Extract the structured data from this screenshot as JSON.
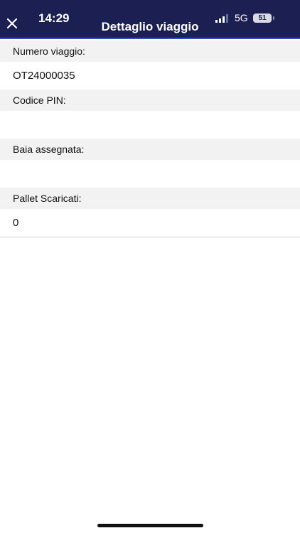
{
  "status_bar": {
    "time": "14:29",
    "network": "5G",
    "battery": "51"
  },
  "header": {
    "title": "Dettaglio viaggio",
    "close_icon": "close-icon"
  },
  "fields": [
    {
      "label": "Numero viaggio:",
      "value": "OT24000035"
    },
    {
      "label": "Codice PIN:",
      "value": ""
    },
    {
      "label": "Baia assegnata:",
      "value": ""
    },
    {
      "label": "Pallet Scaricati:",
      "value": "0"
    }
  ],
  "colors": {
    "header_bg": "#1c1f52",
    "label_bg": "#f2f2f2"
  }
}
